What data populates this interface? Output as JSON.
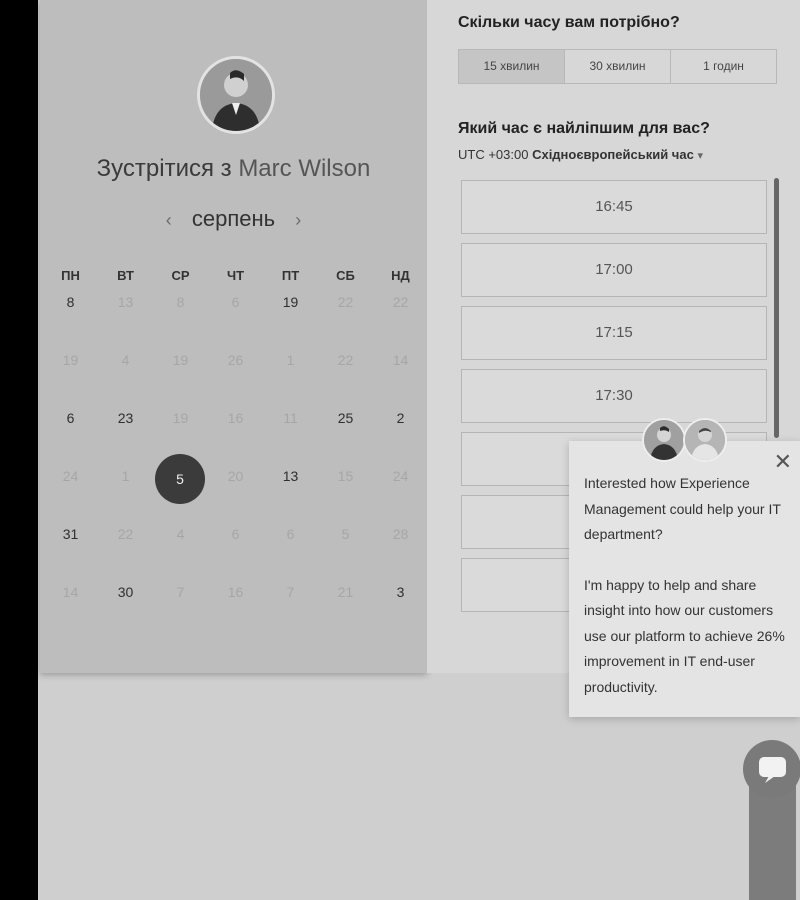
{
  "left": {
    "title_prefix": "Зустрітися з",
    "host_name": "Marc Wilson",
    "month": "серпень",
    "prev_arrow": "‹",
    "next_arrow": "›",
    "weekdays": [
      "ПН",
      "ВТ",
      "СР",
      "ЧТ",
      "ПТ",
      "СБ",
      "НД"
    ],
    "weeks": [
      [
        {
          "d": "8",
          "a": true
        },
        {
          "d": "13",
          "a": false
        },
        {
          "d": "8",
          "a": false
        },
        {
          "d": "6",
          "a": false
        },
        {
          "d": "19",
          "a": true
        },
        {
          "d": "22",
          "a": false
        },
        {
          "d": "22",
          "a": false
        }
      ],
      [
        {
          "d": "19",
          "a": false
        },
        {
          "d": "4",
          "a": false
        },
        {
          "d": "19",
          "a": false
        },
        {
          "d": "26",
          "a": false
        },
        {
          "d": "1",
          "a": false
        },
        {
          "d": "22",
          "a": false
        },
        {
          "d": "14",
          "a": false
        }
      ],
      [
        {
          "d": "6",
          "a": true
        },
        {
          "d": "23",
          "a": true
        },
        {
          "d": "19",
          "a": false
        },
        {
          "d": "16",
          "a": false
        },
        {
          "d": "11",
          "a": false
        },
        {
          "d": "25",
          "a": true
        },
        {
          "d": "2",
          "a": true
        }
      ],
      [
        {
          "d": "24",
          "a": false
        },
        {
          "d": "1",
          "a": false
        },
        {
          "d": "5",
          "a": true,
          "sel": true
        },
        {
          "d": "20",
          "a": false
        },
        {
          "d": "13",
          "a": true
        },
        {
          "d": "15",
          "a": false
        },
        {
          "d": "24",
          "a": false
        }
      ],
      [
        {
          "d": "31",
          "a": true
        },
        {
          "d": "22",
          "a": false
        },
        {
          "d": "4",
          "a": false
        },
        {
          "d": "6",
          "a": false
        },
        {
          "d": "6",
          "a": false
        },
        {
          "d": "5",
          "a": false
        },
        {
          "d": "28",
          "a": false
        }
      ],
      [
        {
          "d": "14",
          "a": false
        },
        {
          "d": "30",
          "a": true
        },
        {
          "d": "7",
          "a": false
        },
        {
          "d": "16",
          "a": false
        },
        {
          "d": "7",
          "a": false
        },
        {
          "d": "21",
          "a": false
        },
        {
          "d": "3",
          "a": true
        }
      ]
    ]
  },
  "right": {
    "duration_heading": "Скільки часу вам потрібно?",
    "durations": [
      "15 хвилин",
      "30 хвилин",
      "1 годин"
    ],
    "time_heading": "Який час є найліпшим для вас?",
    "tz_offset": "UTC +03:00",
    "tz_name": "Східноєвропейський час",
    "tz_caret": "▾",
    "slots": [
      "16:45",
      "17:00",
      "17:15",
      "17:30",
      "",
      "",
      ""
    ]
  },
  "popup": {
    "close": "✕",
    "text1": "Interested how Experience Management could help your IT department?",
    "text2": "I'm happy to help and share insight into how our customers use our platform to achieve 26% improvement in IT end-user productivity."
  },
  "icons": {
    "chat": "chat-bubble-icon",
    "avatar": "person-avatar"
  },
  "colors": {
    "selected_day": "#3b3b3b",
    "panel": "#bdbdbd"
  }
}
